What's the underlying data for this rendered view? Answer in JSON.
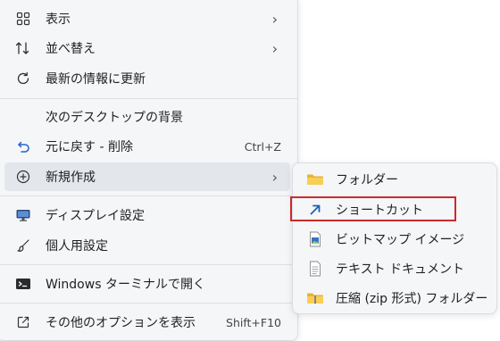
{
  "main_menu": {
    "items": [
      {
        "label": "表示",
        "icon": "grid-view-icon",
        "submenu": true
      },
      {
        "label": "並べ替え",
        "icon": "sort-icon",
        "submenu": true
      },
      {
        "label": "最新の情報に更新",
        "icon": "refresh-icon"
      },
      {
        "label": "次のデスクトップの背景",
        "icon": ""
      },
      {
        "label": "元に戻す - 削除",
        "icon": "undo-icon",
        "shortcut": "Ctrl+Z"
      },
      {
        "label": "新規作成",
        "icon": "add-circle-icon",
        "submenu": true
      },
      {
        "label": "ディスプレイ設定",
        "icon": "display-icon"
      },
      {
        "label": "個人用設定",
        "icon": "brush-icon"
      },
      {
        "label": "Windows ターミナルで開く",
        "icon": "terminal-icon"
      },
      {
        "label": "その他のオプションを表示",
        "icon": "share-icon",
        "shortcut": "Shift+F10"
      }
    ]
  },
  "sub_menu": {
    "items": [
      {
        "label": "フォルダー",
        "icon": "folder-icon"
      },
      {
        "label": "ショートカット",
        "icon": "shortcut-arrow-icon",
        "highlighted": true
      },
      {
        "label": "ビットマップ イメージ",
        "icon": "bitmap-image-icon"
      },
      {
        "label": "テキスト ドキュメント",
        "icon": "text-document-icon"
      },
      {
        "label": "圧縮 (zip 形式) フォルダー",
        "icon": "zip-folder-icon"
      }
    ]
  },
  "colors": {
    "menu_background": "#f4f6f8",
    "hover": "#e3e7ec",
    "highlight_border": "#cc2a2a",
    "folder": "#f5c542",
    "shortcut_arrow": "#1a5fb4"
  }
}
